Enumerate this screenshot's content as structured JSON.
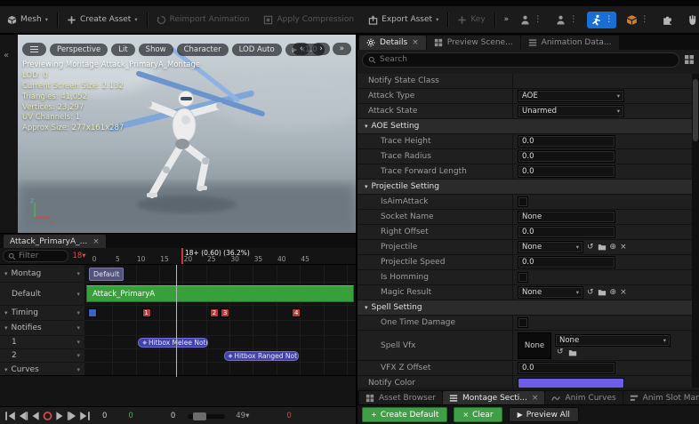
{
  "colors": {
    "accent_blue": "#1a6fd4",
    "segment_green": "#37a03a",
    "button_green": "#3f9e46",
    "notify_purple": "#4242a8",
    "record_red": "#cf4444",
    "notify_color_swatch": "#6c5ce7"
  },
  "toolbar": {
    "items": [
      {
        "id": "mesh",
        "label": "Mesh",
        "caret": true,
        "icon": "cube"
      },
      {
        "id": "create-asset",
        "label": "Create Asset",
        "caret": true,
        "icon": "plus"
      },
      {
        "id": "reimport-animation",
        "label": "Reimport Animation",
        "disabled": true,
        "icon": "reset"
      },
      {
        "id": "apply-compression",
        "label": "Apply Compression",
        "disabled": true,
        "icon": "compress"
      },
      {
        "id": "export-asset",
        "label": "Export Asset",
        "caret": true,
        "icon": "export"
      },
      {
        "id": "key",
        "label": "Key",
        "disabled": true,
        "icon": "plus"
      },
      {
        "id": "overflow",
        "label": "»"
      }
    ],
    "modes": [
      {
        "id": "skeleton-mode",
        "icon": "person"
      },
      {
        "id": "mesh-mode",
        "icon": "person"
      },
      {
        "id": "animation-mode",
        "icon": "run",
        "active": true
      },
      {
        "id": "blueprint-mode",
        "icon": "cube",
        "orange": true
      }
    ],
    "extra_icons": [
      {
        "id": "tools",
        "icon": "puzzle"
      },
      {
        "id": "paint",
        "icon": "hand"
      }
    ],
    "kebab": "⋮"
  },
  "viewport": {
    "collapse_icon": "«",
    "pills": [
      "Perspective",
      "Lit",
      "Show",
      "Character",
      "LOD Auto"
    ],
    "play_pill": "x1.0",
    "nav_pills": [
      "‹",
      "›",
      "»"
    ],
    "stats": [
      "Previewing Montage Attack_PrimaryA_Montage",
      "LOD: 0",
      "Current Screen Size: 2.132",
      "Triangles: 41,052",
      "Vertices: 23,297",
      "UV Channels: 1",
      "Approx Size: 277x161x287"
    ],
    "gizmo": {
      "up": "z",
      "right": "x"
    }
  },
  "timeline": {
    "tab": {
      "label": "Attack_PrimaryA_...",
      "close": "×"
    },
    "filter_placeholder": "Filter",
    "frame_badge": "18▾",
    "playhead": {
      "frame": 18.6,
      "label": "18+ (0.60) (36.2%)"
    },
    "ruler": {
      "labels": [
        "0",
        "5",
        "10",
        "15",
        "20",
        "25",
        "30",
        "35",
        "40",
        "45"
      ]
    },
    "rows": [
      {
        "id": "montage-group",
        "label": "Montag",
        "expander": true
      },
      {
        "id": "slot-track",
        "label": "Default",
        "expander": false
      },
      {
        "id": "timing-track",
        "label": "Timing",
        "expander": true
      },
      {
        "id": "notifies-group",
        "label": "Notifies",
        "expander": true
      },
      {
        "id": "notify-track-1",
        "label": "1",
        "expander": false
      },
      {
        "id": "notify-track-2",
        "label": "2",
        "expander": false
      },
      {
        "id": "curves-group",
        "label": "Curves",
        "expander": true
      }
    ],
    "slot_chip": "Default",
    "segment_label": "Attack_PrimaryA",
    "timing_markers": [
      {
        "label": "",
        "frame": 0,
        "color": "#3a62c4"
      },
      {
        "label": "1",
        "frame": 11.5,
        "color": "#b23b3b"
      },
      {
        "label": "2",
        "frame": 26,
        "color": "#b23b3b"
      },
      {
        "label": "3",
        "frame": 28.3,
        "color": "#b23b3b"
      },
      {
        "label": "4",
        "frame": 43.5,
        "color": "#b23b3b"
      }
    ],
    "notifies": [
      {
        "track": 4,
        "label": "Hitbox Melee Notif",
        "frame": 10.5,
        "len": 15,
        "diamond": "◆"
      },
      {
        "track": 5,
        "label": "Hitbox Ranged Not",
        "frame": 28.8,
        "len": 16,
        "diamond": "◆"
      }
    ],
    "transport": {
      "buttons": [
        "skip-first",
        "step-back",
        "play-reverse",
        "record",
        "play",
        "step-forward",
        "skip-last"
      ],
      "values": [
        {
          "text": "0",
          "color": "#c8c8c8"
        },
        {
          "text": "0",
          "color": "#55a855"
        },
        {
          "text": "0",
          "color": "#c8c8c8"
        }
      ],
      "fps": "49▾",
      "end_value": {
        "text": "0",
        "color": "#c05050"
      }
    }
  },
  "details": {
    "tabs": [
      {
        "label": "Details",
        "active": true,
        "close": "×",
        "icon": "gear"
      },
      {
        "label": "Preview Scene...",
        "icon": "grid"
      },
      {
        "label": "Animation Data...",
        "icon": "list"
      }
    ],
    "search_placeholder": "Search",
    "rows": [
      {
        "type": "plain",
        "label": "Notify State Class",
        "indent": 1
      },
      {
        "type": "dropdown",
        "label": "Attack Type",
        "value": "AOE",
        "indent": 1
      },
      {
        "type": "dropdown",
        "label": "Attack State",
        "value": "Unarmed",
        "indent": 1
      },
      {
        "type": "category",
        "label": "AOE Setting"
      },
      {
        "type": "number",
        "label": "Trace Height",
        "value": "0.0",
        "indent": 2
      },
      {
        "type": "number",
        "label": "Trace Radius",
        "value": "0.0",
        "indent": 2
      },
      {
        "type": "number",
        "label": "Trace Forward Length",
        "value": "0.0",
        "indent": 2
      },
      {
        "type": "category",
        "label": "Projectile Setting"
      },
      {
        "type": "checkbox",
        "label": "IsAimAttack",
        "checked": false,
        "indent": 2
      },
      {
        "type": "text",
        "label": "Socket Name",
        "value": "None",
        "indent": 2
      },
      {
        "type": "number",
        "label": "Right Offset",
        "value": "0.0",
        "indent": 2
      },
      {
        "type": "asset",
        "label": "Projectile",
        "value": "None",
        "indent": 2
      },
      {
        "type": "number",
        "label": "Projectile Speed",
        "value": "0.0",
        "indent": 2
      },
      {
        "type": "checkbox",
        "label": "Is Homming",
        "checked": false,
        "indent": 2
      },
      {
        "type": "asset",
        "label": "Magic Result",
        "value": "None",
        "indent": 2
      },
      {
        "type": "category",
        "label": "Spell Setting"
      },
      {
        "type": "checkbox",
        "label": "One Time Damage",
        "checked": false,
        "indent": 2
      },
      {
        "type": "map",
        "label": "Spell Vfx",
        "key": "None",
        "value": "None",
        "indent": 2
      },
      {
        "type": "number",
        "label": "VFX Z Offset",
        "value": "0.0",
        "indent": 2
      },
      {
        "type": "color",
        "label": "Notify Color",
        "value": "#6c5ce7",
        "indent": 1
      }
    ]
  },
  "bottom_tabs": [
    {
      "label": "Asset Browser",
      "icon": "grid"
    },
    {
      "label": "Montage Secti...",
      "icon": "list",
      "active": true,
      "close": "×"
    },
    {
      "label": "Anim Curves",
      "icon": "wave"
    },
    {
      "label": "Anim Slot Man...",
      "icon": "slots"
    }
  ],
  "actions": [
    {
      "id": "create-default",
      "label": "Create Default",
      "style": "green",
      "glyph": "+"
    },
    {
      "id": "clear",
      "label": "Clear",
      "style": "green",
      "glyph": "×"
    },
    {
      "id": "preview-all",
      "label": "Preview All",
      "style": "dark",
      "glyph": "▶"
    }
  ]
}
